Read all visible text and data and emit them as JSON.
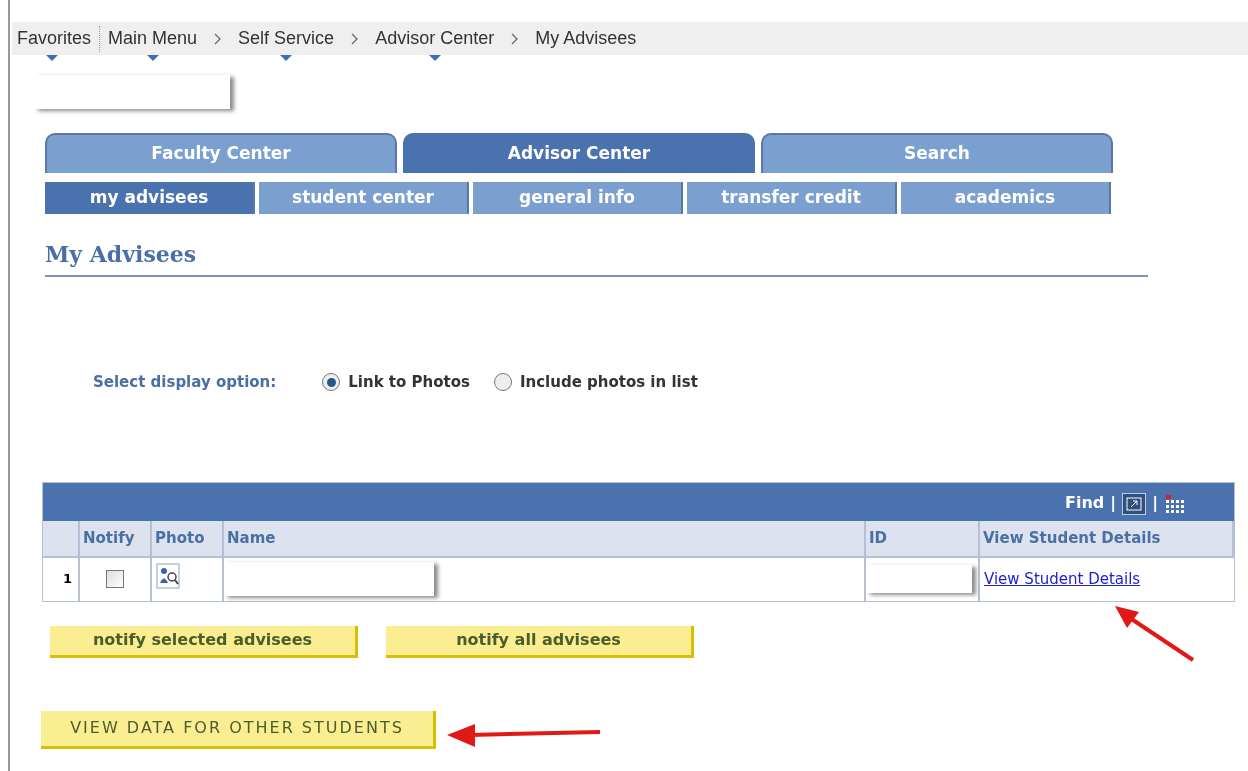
{
  "breadcrumb": [
    {
      "label": "Favorites",
      "menu": true
    },
    {
      "label": "Main Menu",
      "menu": true
    },
    {
      "label": "Self Service",
      "menu": true
    },
    {
      "label": "Advisor Center",
      "menu": true
    },
    {
      "label": "My Advisees",
      "menu": false
    }
  ],
  "tabs": [
    {
      "label": "Faculty Center",
      "selected": false
    },
    {
      "label": "Advisor Center",
      "selected": true
    },
    {
      "label": "Search",
      "selected": false
    }
  ],
  "subtabs": [
    {
      "label": "my advisees",
      "selected": true
    },
    {
      "label": "student center",
      "selected": false
    },
    {
      "label": "general info",
      "selected": false
    },
    {
      "label": "transfer credit",
      "selected": false
    },
    {
      "label": "academics",
      "selected": false
    }
  ],
  "heading": "My Advisees",
  "display_option": {
    "label": "Select display option:",
    "options": [
      {
        "label": "Link to Photos",
        "selected": true
      },
      {
        "label": "Include photos in list",
        "selected": false
      }
    ]
  },
  "grid": {
    "toolbar": {
      "find": "Find",
      "separator_1": "|",
      "separator_2": "|"
    },
    "columns": [
      "Notify",
      "Photo",
      "Name",
      "ID",
      "View Student Details"
    ],
    "rows": [
      {
        "number": "1",
        "notify": false,
        "link": "View Student Details"
      }
    ]
  },
  "buttons": [
    "notify selected advisees",
    "notify all advisees"
  ],
  "other_students_button": "VIEW DATA FOR OTHER STUDENTS"
}
